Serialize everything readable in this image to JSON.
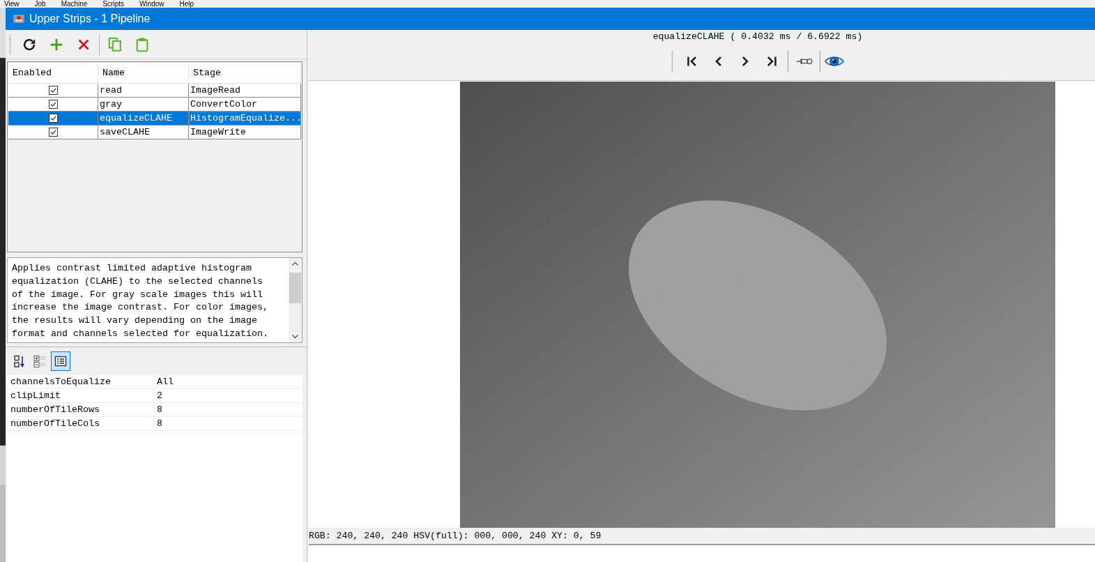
{
  "menu_bar": {
    "items": [
      "View",
      "Job",
      "Machine",
      "Scripts",
      "Window",
      "Help"
    ]
  },
  "window": {
    "title": "Upper Strips - 1 Pipeline"
  },
  "pipeline_table": {
    "columns": [
      "Enabled",
      "Name",
      "Stage"
    ],
    "rows": [
      {
        "enabled": true,
        "name": "read",
        "stage": "ImageRead",
        "selected": false
      },
      {
        "enabled": true,
        "name": "gray",
        "stage": "ConvertColor",
        "selected": false
      },
      {
        "enabled": true,
        "name": "equalizeCLAHE",
        "stage": "HistogramEqualize...",
        "selected": true
      },
      {
        "enabled": true,
        "name": "saveCLAHE",
        "stage": "ImageWrite",
        "selected": false
      }
    ]
  },
  "description": {
    "text": "Applies contrast limited adaptive histogram equalization (CLAHE) to the selected channels of the image. For gray scale images this will increase the image contrast. For color images, the results will vary depending on the image format and channels selected for equalization."
  },
  "properties": {
    "view_buttons": [
      {
        "kind": "alphabetical",
        "selected": false
      },
      {
        "kind": "categorized",
        "selected": false
      },
      {
        "kind": "list",
        "selected": true
      }
    ],
    "rows": [
      {
        "name": "channelsToEqualize",
        "value": "All"
      },
      {
        "name": "clipLimit",
        "value": "2"
      },
      {
        "name": "numberOfTileRows",
        "value": "8"
      },
      {
        "name": "numberOfTileCols",
        "value": "8"
      }
    ]
  },
  "viewer": {
    "caption": "equalizeCLAHE ( 0.4032 ms / 6.6922 ms)",
    "status": "RGB: 240, 240, 240 HSV(full): 000, 000, 240 XY: 0, 59"
  }
}
